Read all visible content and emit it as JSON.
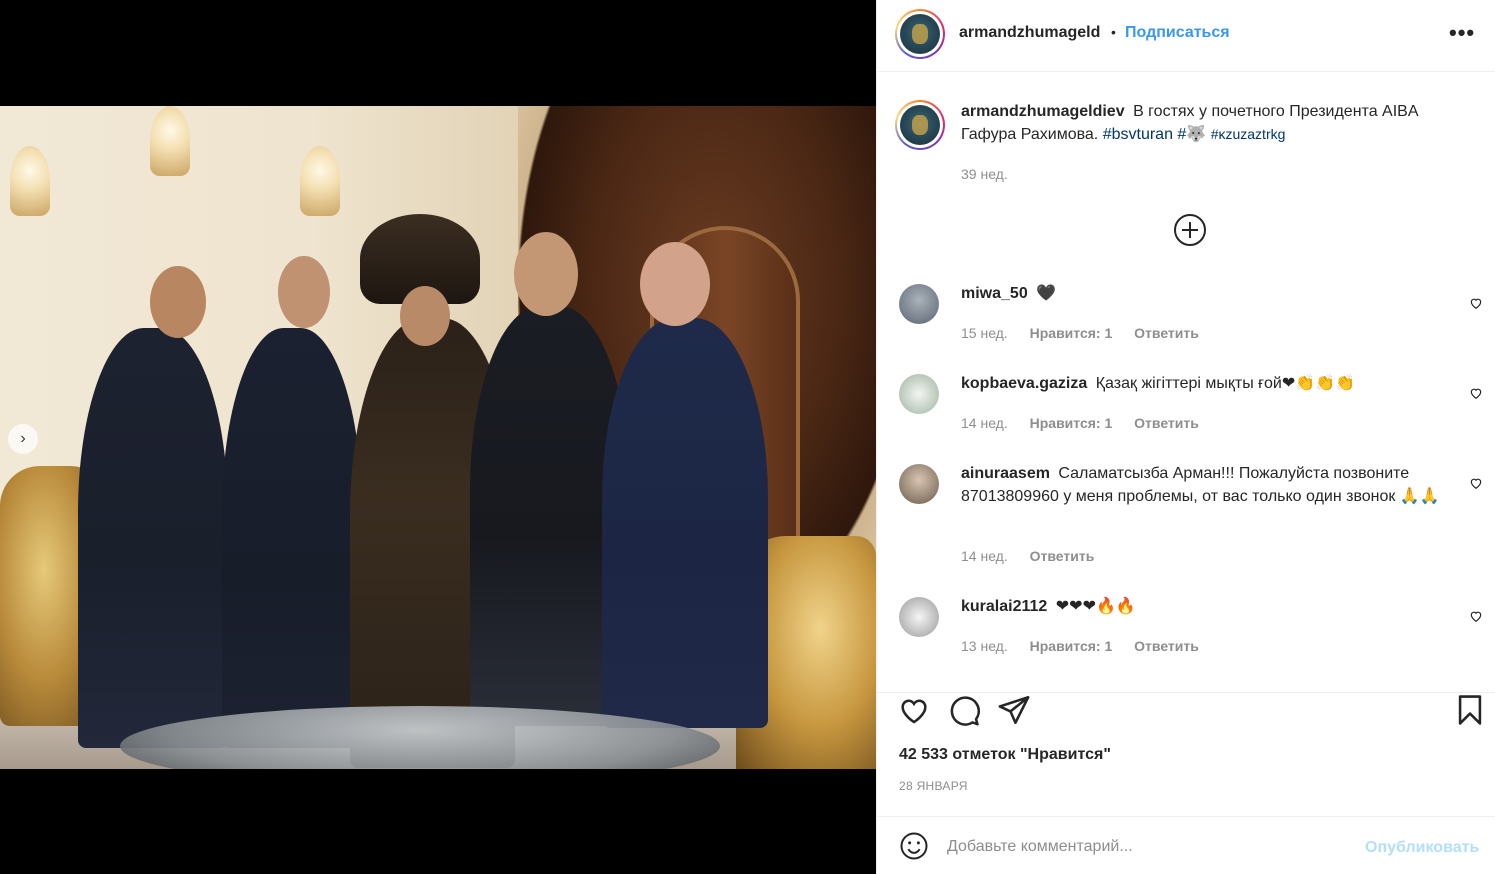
{
  "post_header": {
    "username": "armandzhumageld",
    "separator": "•",
    "follow_label": "Подписаться",
    "more_label": "•••"
  },
  "caption": {
    "username": "armandzhumageldiev",
    "text": "В гостях у почетного Президента AIBA Гафура Рахимова.",
    "hashtag1": "#bsvturan",
    "hashtag2": "#🐺",
    "hashtag3": "#ĸzuzaztrkg",
    "time": "39 нед."
  },
  "comments": [
    {
      "username": "miwa_50",
      "text": "🖤",
      "time": "15 нед.",
      "likes": "Нравится: 1",
      "reply": "Ответить"
    },
    {
      "username": "kopbaeva.gaziza",
      "text": "Қазақ жігіттері мықты ғой❤👏👏👏",
      "time": "14 нед.",
      "likes": "Нравится: 1",
      "reply": "Ответить"
    },
    {
      "username": "ainuraasem",
      "text": "Саламатсызба Арман!!! Пожалуйста позвоните 87013809960 у меня проблемы, от вас только один звонок 🙏🙏",
      "time": "14 нед.",
      "likes": "",
      "reply": "Ответить"
    },
    {
      "username": "kuralai2112",
      "text": "❤❤❤🔥🔥",
      "time": "13 нед.",
      "likes": "Нравится: 1",
      "reply": "Ответить"
    }
  ],
  "actions": {
    "like_icon": "heart-icon",
    "comment_icon": "comment-icon",
    "share_icon": "share-icon",
    "save_icon": "bookmark-icon"
  },
  "likes_text": "42 533 отметок \"Нравится\"",
  "date_text": "28 ЯНВАРЯ",
  "add_comment": {
    "placeholder": "Добавьте комментарий...",
    "post_label": "Опубликовать"
  },
  "colors": {
    "link": "#3897f0",
    "hashtag": "#00376b",
    "muted": "#8e8e8e",
    "post_disabled": "#b2dffc"
  }
}
